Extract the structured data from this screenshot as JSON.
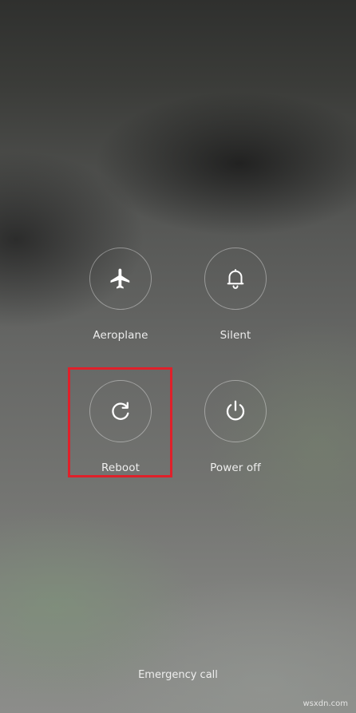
{
  "power_menu": {
    "actions": [
      {
        "id": "aeroplane",
        "label": "Aeroplane",
        "icon": "airplane-icon"
      },
      {
        "id": "silent",
        "label": "Silent",
        "icon": "bell-icon"
      },
      {
        "id": "reboot",
        "label": "Reboot",
        "icon": "reboot-icon",
        "highlighted": true
      },
      {
        "id": "power_off",
        "label": "Power off",
        "icon": "power-icon"
      }
    ],
    "highlight_color": "#e0202a",
    "emergency_call_label": "Emergency call"
  },
  "watermark": "wsxdn.com"
}
